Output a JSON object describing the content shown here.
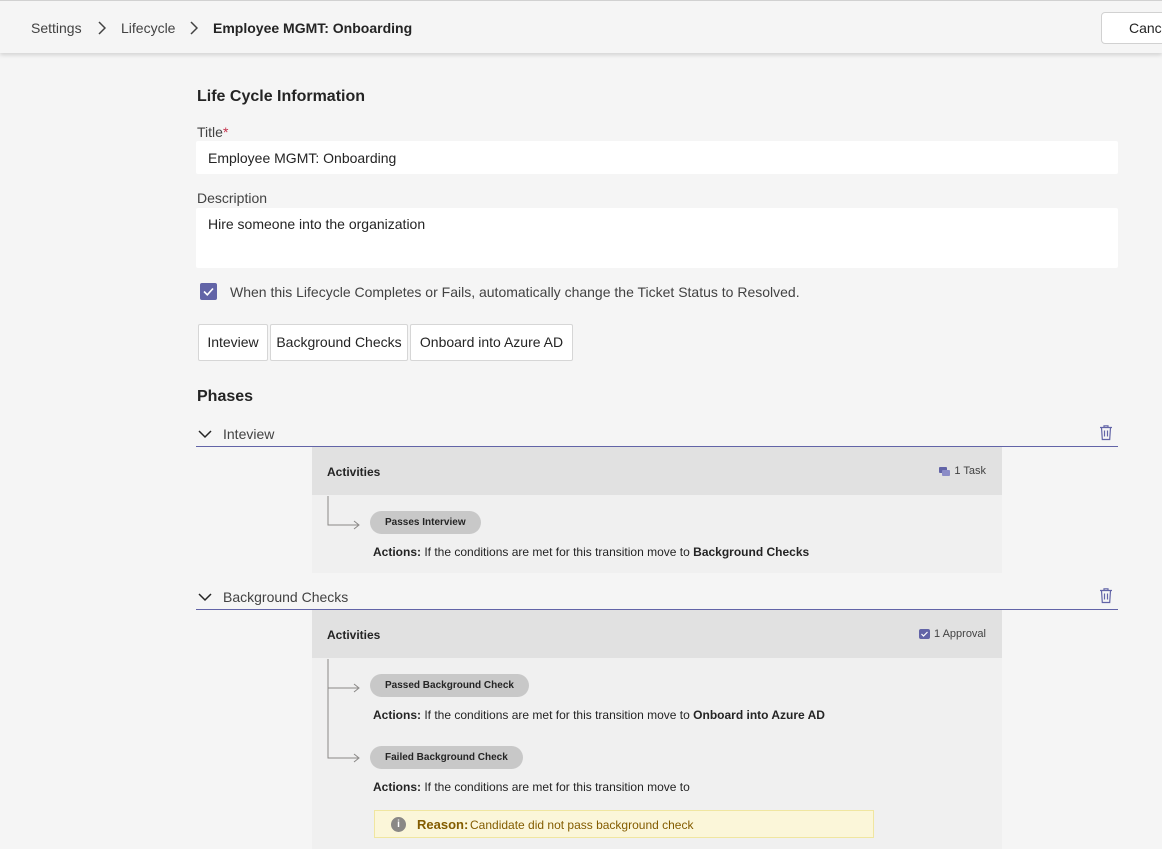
{
  "breadcrumb": {
    "items": [
      "Settings",
      "Lifecycle",
      "Employee MGMT: Onboarding"
    ]
  },
  "header": {
    "cancel_label": "Cance"
  },
  "form": {
    "section_title": "Life Cycle Information",
    "title_label": "Title",
    "title_required_mark": "*",
    "title_value": "Employee MGMT: Onboarding",
    "description_label": "Description",
    "description_value": "Hire someone into the organization",
    "auto_resolve_checked": true,
    "auto_resolve_label": "When this Lifecycle Completes or Fails, automatically change the Ticket Status to Resolved."
  },
  "phase_tabs": [
    "Inteview",
    "Background Checks",
    "Onboard into Azure AD"
  ],
  "phases_title": "Phases",
  "phases": [
    {
      "name": "Inteview",
      "activities_label": "Activities",
      "count_label": "1 Task",
      "transitions": [
        {
          "pill": "Passes Interview",
          "actions_label": "Actions:",
          "actions_text": "If the conditions are met for this transition move to",
          "target": "Background Checks"
        }
      ]
    },
    {
      "name": "Background Checks",
      "activities_label": "Activities",
      "count_label": "1 Approval",
      "transitions": [
        {
          "pill": "Passed Background Check",
          "actions_label": "Actions:",
          "actions_text": "If the conditions are met for this transition move to",
          "target": "Onboard into Azure AD"
        },
        {
          "pill": "Failed Background Check",
          "actions_label": "Actions:",
          "actions_text": "If the conditions are met for this transition move to",
          "target": ""
        }
      ],
      "reason": {
        "label": "Reason:",
        "text": "Candidate did not pass background check"
      }
    }
  ],
  "colors": {
    "accent": "#6264a7",
    "background": "#f5f5f5",
    "reason_background": "#fbf6d9"
  },
  "icons": [
    "chevron-right-icon",
    "checkmark-icon",
    "chevron-down-icon",
    "trash-icon",
    "task-icon",
    "approval-icon",
    "info-icon"
  ]
}
